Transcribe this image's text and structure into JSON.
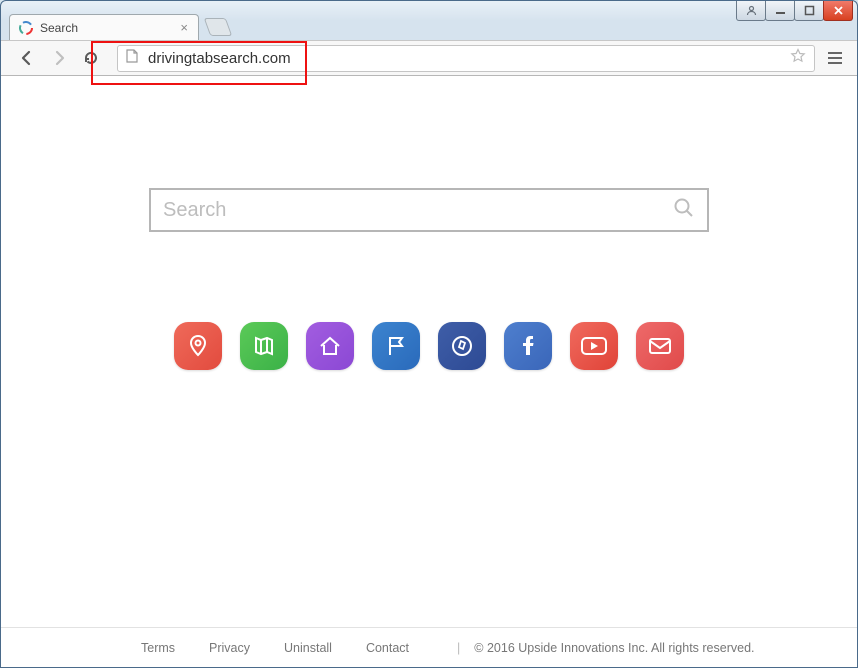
{
  "window": {
    "controls": {
      "user": "user",
      "min": "min",
      "max": "max",
      "close": "close"
    }
  },
  "tab": {
    "title": "Search",
    "close": "×"
  },
  "toolbar": {
    "back": "back",
    "forward": "forward",
    "reload": "reload",
    "menu": "menu"
  },
  "omnibox": {
    "url": "drivingtabsearch.com",
    "star": "star"
  },
  "search": {
    "placeholder": "Search"
  },
  "shortcuts": {
    "location": "location-pin-icon",
    "map": "map-icon",
    "home": "home-icon",
    "flag": "flag-icon",
    "compass": "compass-icon",
    "facebook": "facebook-icon",
    "youtube": "youtube-play-icon",
    "mail": "mail-icon"
  },
  "footer": {
    "terms": "Terms",
    "privacy": "Privacy",
    "uninstall": "Uninstall",
    "contact": "Contact",
    "separator": "|",
    "copyright": "© 2016 Upside Innovations Inc. All rights reserved."
  }
}
